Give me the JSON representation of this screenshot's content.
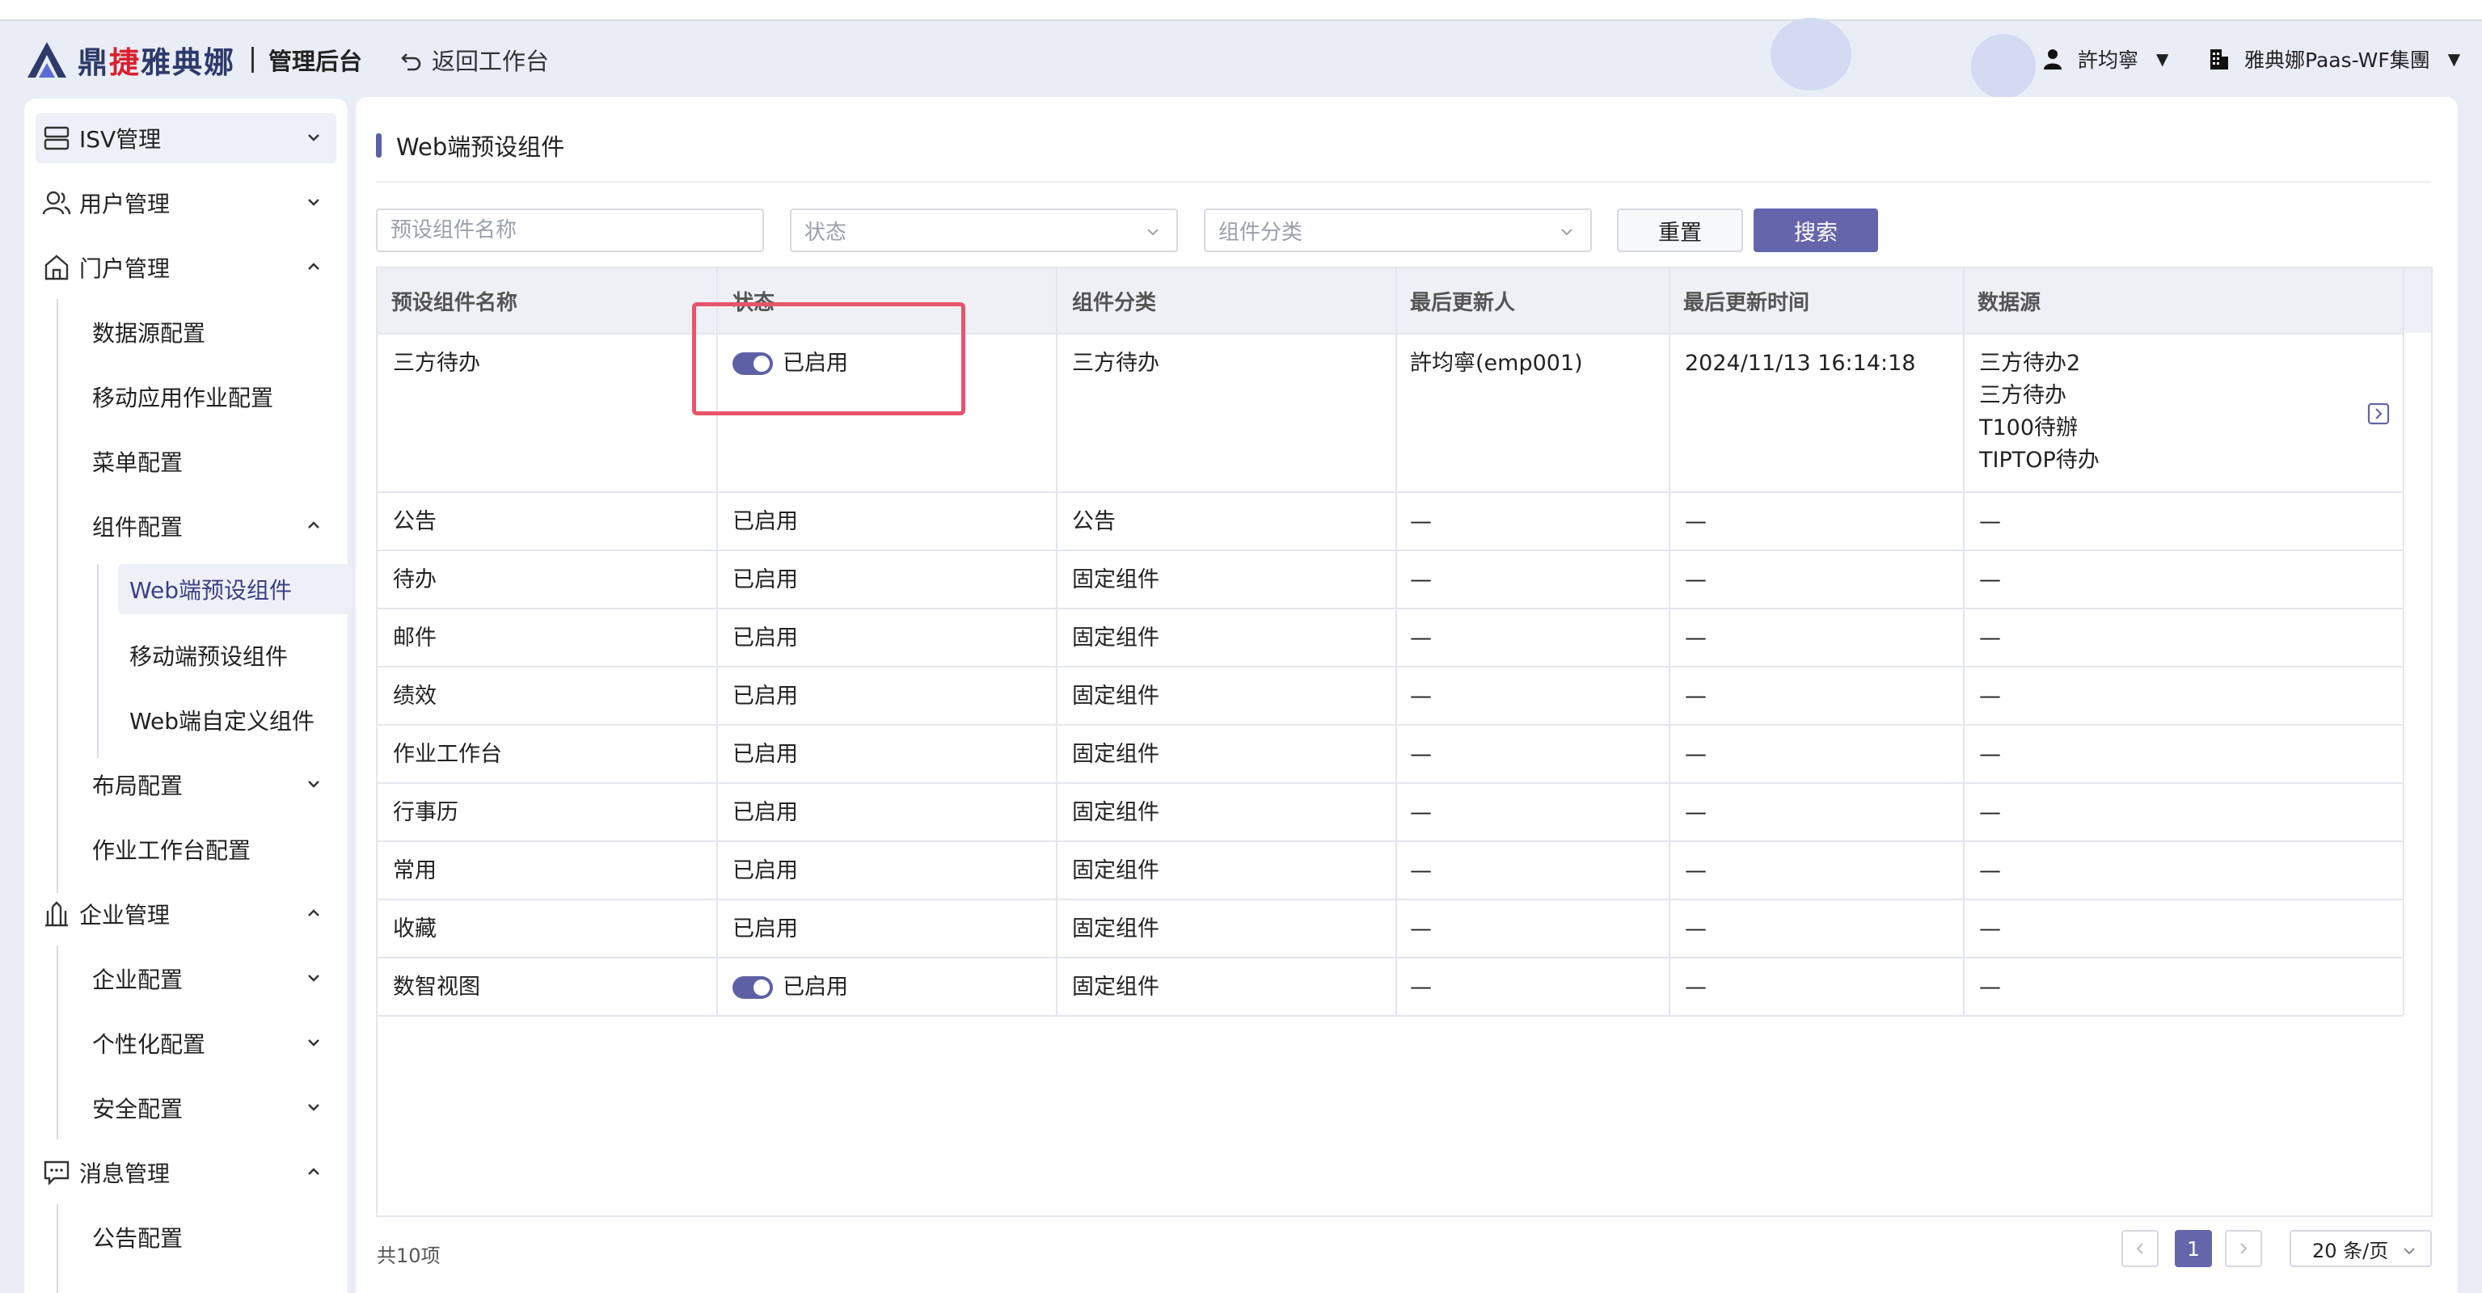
{
  "header": {
    "brand_prefix": "鼎",
    "brand_accent": "捷",
    "brand_suffix": "雅典娜",
    "brand_sub": "管理后台",
    "back_label": "返回工作台",
    "user_name": "許均寧",
    "tenant_name": "雅典娜Paas-WF集團"
  },
  "sidebar": {
    "isv": "ISV管理",
    "users": "用户管理",
    "portal": "门户管理",
    "portal_items": {
      "datasource": "数据源配置",
      "mobile_app": "移动应用作业配置",
      "menu": "菜单配置",
      "component": "组件配置",
      "layout": "布局配置",
      "workbench": "作业工作台配置"
    },
    "component_items": {
      "web_preset": "Web端预设组件",
      "mobile_preset": "移动端预设组件",
      "web_custom": "Web端自定义组件"
    },
    "enterprise": "企业管理",
    "enterprise_items": {
      "config": "企业配置",
      "personal": "个性化配置",
      "security": "安全配置"
    },
    "message": "消息管理",
    "message_items": {
      "notice": "公告配置"
    }
  },
  "page": {
    "title": "Web端预设组件"
  },
  "filters": {
    "name_placeholder": "预设组件名称",
    "status_placeholder": "状态",
    "category_placeholder": "组件分类",
    "reset_label": "重置",
    "search_label": "搜索"
  },
  "table": {
    "columns": [
      "预设组件名称",
      "状态",
      "组件分类",
      "最后更新人",
      "最后更新时间",
      "数据源"
    ],
    "rows": [
      {
        "name": "三方待办",
        "status": "已启用",
        "toggle": true,
        "category": "三方待办",
        "updater": "許均寧(emp001)",
        "time": "2024/11/13 16:14:18",
        "sources": [
          "三方待办2",
          "三方待办",
          "T100待辦",
          "TIPTOP待办"
        ]
      },
      {
        "name": "公告",
        "status": "已启用",
        "toggle": false,
        "category": "公告",
        "updater": "—",
        "time": "—",
        "sources": [
          "—"
        ]
      },
      {
        "name": "待办",
        "status": "已启用",
        "toggle": false,
        "category": "固定组件",
        "updater": "—",
        "time": "—",
        "sources": [
          "—"
        ]
      },
      {
        "name": "邮件",
        "status": "已启用",
        "toggle": false,
        "category": "固定组件",
        "updater": "—",
        "time": "—",
        "sources": [
          "—"
        ]
      },
      {
        "name": "绩效",
        "status": "已启用",
        "toggle": false,
        "category": "固定组件",
        "updater": "—",
        "time": "—",
        "sources": [
          "—"
        ]
      },
      {
        "name": "作业工作台",
        "status": "已启用",
        "toggle": false,
        "category": "固定组件",
        "updater": "—",
        "time": "—",
        "sources": [
          "—"
        ]
      },
      {
        "name": "行事历",
        "status": "已启用",
        "toggle": false,
        "category": "固定组件",
        "updater": "—",
        "time": "—",
        "sources": [
          "—"
        ]
      },
      {
        "name": "常用",
        "status": "已启用",
        "toggle": false,
        "category": "固定组件",
        "updater": "—",
        "time": "—",
        "sources": [
          "—"
        ]
      },
      {
        "name": "收藏",
        "status": "已启用",
        "toggle": false,
        "category": "固定组件",
        "updater": "—",
        "time": "—",
        "sources": [
          "—"
        ]
      },
      {
        "name": "数智视图",
        "status": "已启用",
        "toggle": true,
        "category": "固定组件",
        "updater": "—",
        "time": "—",
        "sources": [
          "—"
        ]
      }
    ]
  },
  "pagination": {
    "total": "共10项",
    "current_page": "1",
    "page_size": "20 条/页"
  },
  "colors": {
    "accent": "#6465ab",
    "highlight": "#e8546a"
  }
}
